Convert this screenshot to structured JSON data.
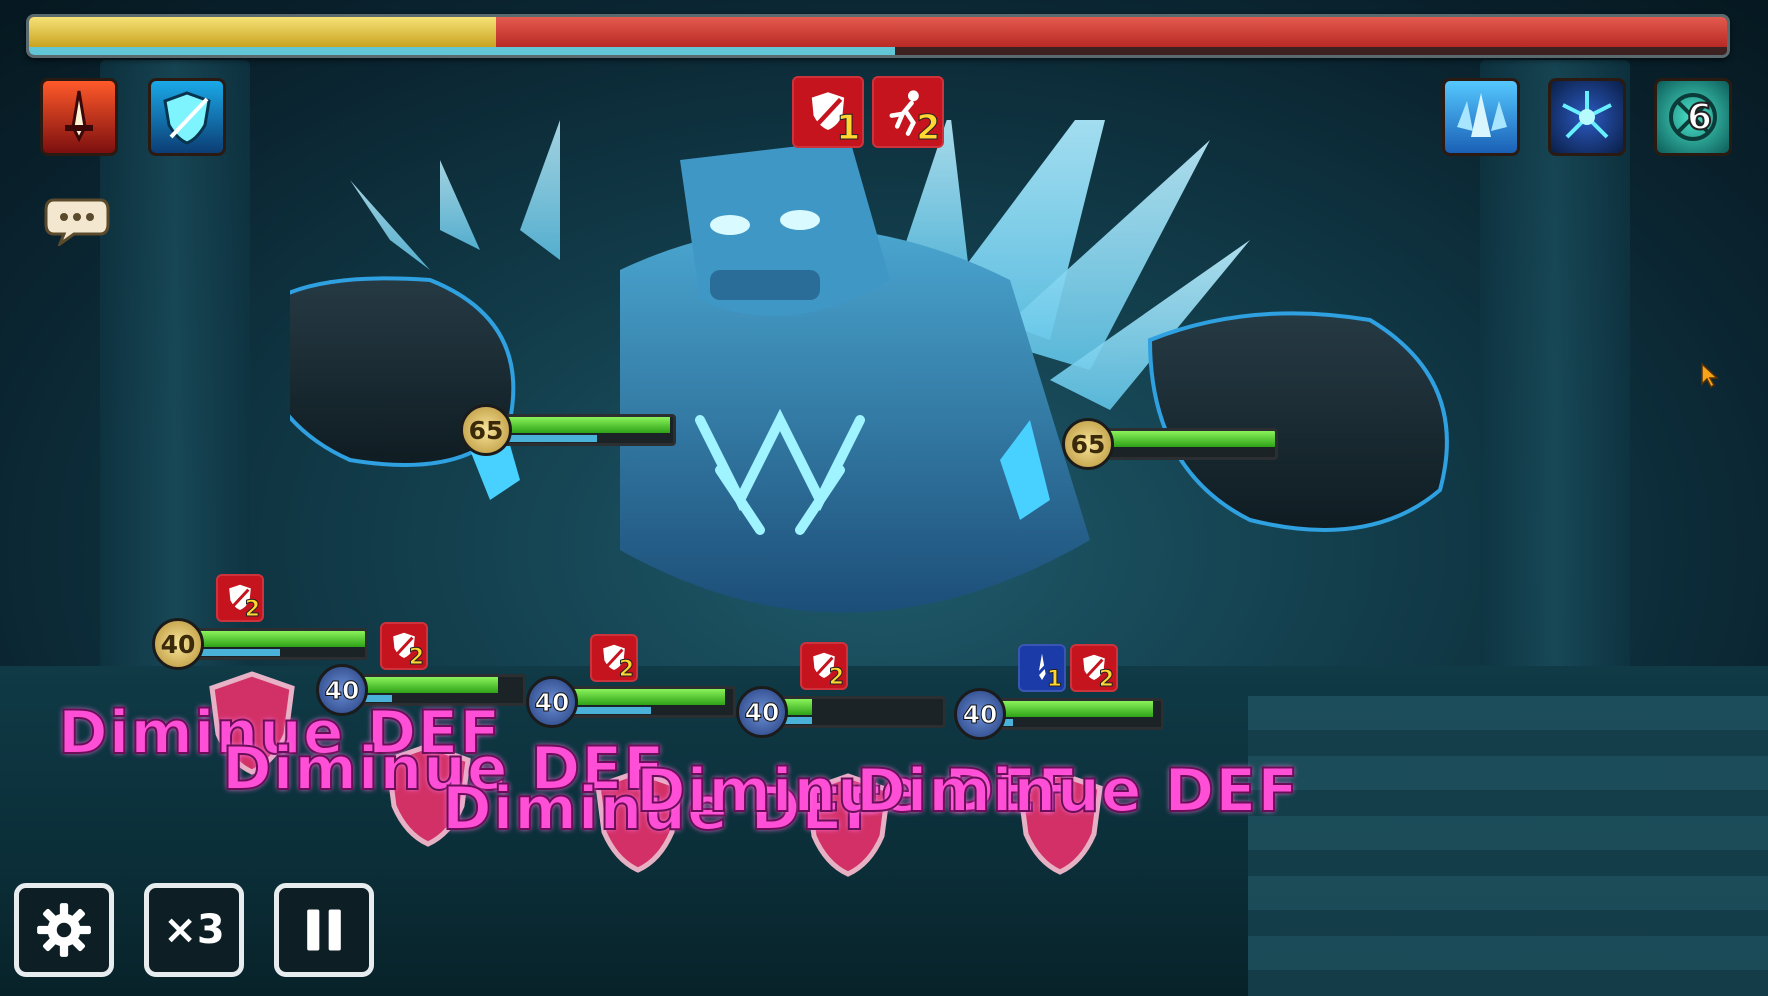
{
  "boss_hp": {
    "hp_fraction": 0.275,
    "atb_fraction": 0.51
  },
  "left_buffs": [
    {
      "icon": "sword-attack-up-icon",
      "color": "#d6302a"
    },
    {
      "icon": "defense-up-shield-icon",
      "color": "#1e8fd4"
    }
  ],
  "center_debuffs": [
    {
      "icon": "defense-break-icon",
      "count": "1"
    },
    {
      "icon": "slow-icon",
      "count": "2"
    }
  ],
  "right_buffs": [
    {
      "icon": "ice-shard-icon",
      "color": "#2f9fe6",
      "count": ""
    },
    {
      "icon": "ice-nova-icon",
      "color": "#123a7a",
      "count": ""
    },
    {
      "icon": "frost-emblem-icon",
      "color": "#16a7a0",
      "count": "6"
    }
  ],
  "boss_hands": [
    {
      "name": "left-fist",
      "level": "65",
      "hp_fraction": 0.98,
      "atb_fraction": 0.55
    },
    {
      "name": "right-fist",
      "level": "65",
      "hp_fraction": 1.0,
      "atb_fraction": 0.0
    }
  ],
  "team": [
    {
      "level": "40",
      "hp_fraction": 1.0,
      "atb_fraction": 0.5,
      "badge": "gold",
      "debuffs": [
        "2"
      ]
    },
    {
      "level": "40",
      "hp_fraction": 0.85,
      "atb_fraction": 0.2,
      "badge": "blue",
      "debuffs": [
        "2"
      ]
    },
    {
      "level": "40",
      "hp_fraction": 0.95,
      "atb_fraction": 0.5,
      "badge": "blue",
      "debuffs": [
        "2"
      ]
    },
    {
      "level": "40",
      "hp_fraction": 0.2,
      "atb_fraction": 0.2,
      "badge": "blue",
      "debuffs": [
        "2"
      ]
    },
    {
      "level": "40",
      "hp_fraction": 0.95,
      "atb_fraction": 0.1,
      "badge": "blue",
      "debuffs": [
        "1",
        "2"
      ]
    }
  ],
  "floating_text": "Diminue DEF",
  "controls": {
    "settings_label": "",
    "speed_label": "×3",
    "pause_label": ""
  },
  "colors": {
    "hp_red": "#c0312b",
    "hp_yellow": "#e8c84a",
    "atb_blue": "#61c6d6",
    "fx_magenta": "#ff4fd6"
  }
}
